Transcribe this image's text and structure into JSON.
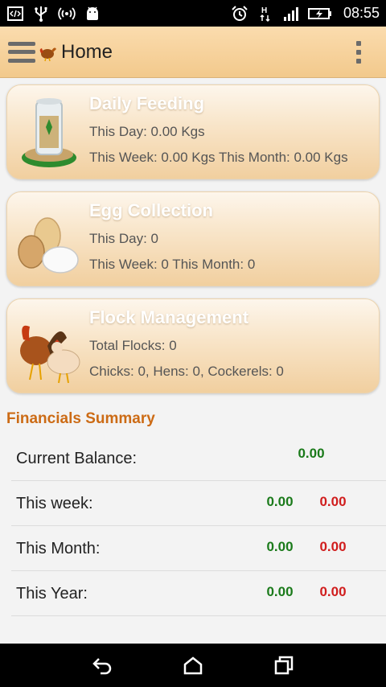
{
  "status_bar": {
    "time": "08:55",
    "icons": [
      "code-icon",
      "usb-icon",
      "hotspot-icon",
      "android-icon",
      "alarm-icon",
      "hspa-icon",
      "signal-icon",
      "battery-charging-icon"
    ]
  },
  "action_bar": {
    "title": "Home",
    "icons": [
      "menu-icon",
      "hen-logo-icon",
      "overflow-menu-icon"
    ]
  },
  "cards": {
    "feeding": {
      "title": "Daily Feeding",
      "line1": "This Day: 0.00 Kgs",
      "line2": "This Week: 0.00 Kgs  This Month: 0.00 Kgs"
    },
    "eggs": {
      "title": "Egg Collection",
      "line1": "This Day: 0",
      "line2": "This Week: 0  This Month: 0"
    },
    "flock": {
      "title": "Flock Management",
      "line1": "Total Flocks: 0",
      "line2": "Chicks: 0,  Hens: 0,  Cockerels: 0"
    }
  },
  "financials": {
    "title": "Financials Summary",
    "rows": [
      {
        "label": "Current Balance:",
        "value": "0.00"
      },
      {
        "label": "This week:",
        "income": "0.00",
        "expense": "0.00"
      },
      {
        "label": "This Month:",
        "income": "0.00",
        "expense": "0.00"
      },
      {
        "label": "This Year:",
        "income": "0.00",
        "expense": "0.00"
      }
    ],
    "colors": {
      "income": "#1a7a1a",
      "expense": "#d01d1d",
      "title": "#cc6b15"
    }
  },
  "nav_bar": {
    "icons": [
      "back-icon",
      "home-icon",
      "recents-icon"
    ]
  }
}
